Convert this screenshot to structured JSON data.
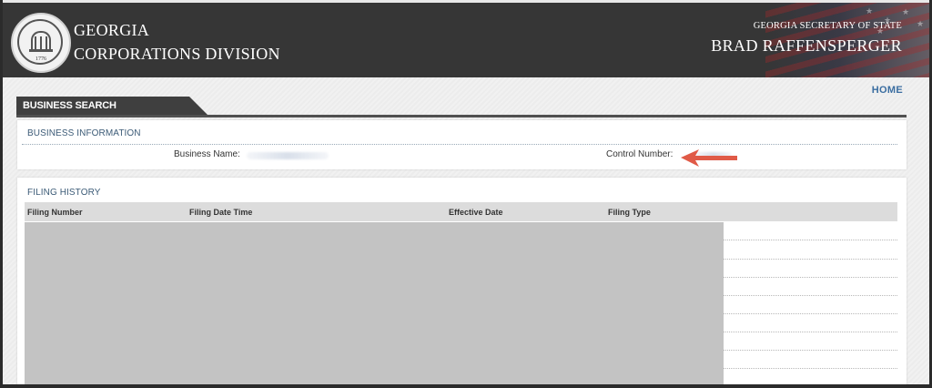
{
  "header": {
    "seal_year": "1776",
    "title_line1": "GEORGIA",
    "title_line2": "CORPORATIONS DIVISION",
    "secretary_label": "GEORGIA SECRETARY OF STATE",
    "secretary_name": "BRAD RAFFENSPERGER"
  },
  "nav": {
    "home": "HOME"
  },
  "tab": {
    "label": "BUSINESS SEARCH"
  },
  "business_info": {
    "section_title": "BUSINESS INFORMATION",
    "business_name_label": "Business Name:",
    "control_number_label": "Control Number:"
  },
  "filing_history": {
    "section_title": "FILING HISTORY",
    "columns": [
      "Filing Number",
      "Filing Date Time",
      "Effective Date",
      "Filing Type"
    ]
  },
  "colors": {
    "header_bg": "#363636",
    "accent": "#3b6ea1",
    "arrow": "#e05a47"
  }
}
